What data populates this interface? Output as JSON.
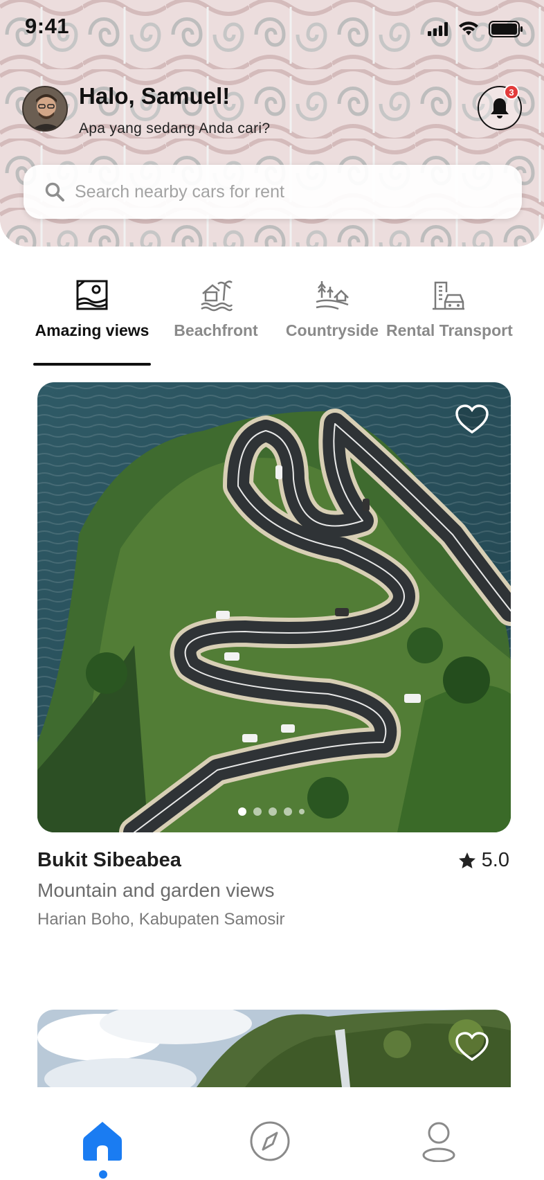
{
  "status_bar": {
    "time": "9:41"
  },
  "header": {
    "greeting": "Halo, Samuel!",
    "subgreeting": "Apa yang sedang Anda cari?",
    "notification_count": "3"
  },
  "search": {
    "placeholder": "Search nearby cars for rent"
  },
  "categories": [
    {
      "label": "Amazing views",
      "icon": "map-picture-icon",
      "active": true
    },
    {
      "label": "Beachfront",
      "icon": "beach-house-icon",
      "active": false
    },
    {
      "label": "Countryside",
      "icon": "countryside-icon",
      "active": false
    },
    {
      "label": "Rental Transport",
      "icon": "car-building-icon",
      "active": false
    }
  ],
  "listings": [
    {
      "title": "Bukit Sibeabea",
      "rating": "5.0",
      "subtitle": "Mountain and garden views",
      "location": "Harian Boho, Kabupaten Samosir",
      "image_count": 5,
      "active_image": 1
    }
  ],
  "bottom_nav": [
    {
      "icon": "home-icon",
      "active": true
    },
    {
      "icon": "compass-icon",
      "active": false
    },
    {
      "icon": "profile-icon",
      "active": false
    }
  ],
  "colors": {
    "accent": "#1a7cf2",
    "badge": "#e23b3b"
  }
}
